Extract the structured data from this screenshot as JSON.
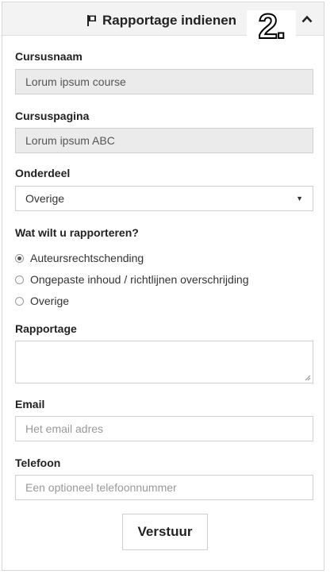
{
  "header": {
    "title": "Rapportage indienen",
    "badge": "2."
  },
  "form": {
    "course_name": {
      "label": "Cursusnaam",
      "value": "Lorum ipsum course"
    },
    "course_page": {
      "label": "Cursuspagina",
      "value": "Lorum ipsum ABC"
    },
    "section": {
      "label": "Onderdeel",
      "selected": "Overige"
    },
    "report_type": {
      "label": "Wat wilt u rapporteren?",
      "options": [
        {
          "label": "Auteursrechtschending",
          "checked": true
        },
        {
          "label": "Ongepaste inhoud / richtlijnen overschrijding",
          "checked": false
        },
        {
          "label": "Overige",
          "checked": false
        }
      ]
    },
    "report": {
      "label": "Rapportage",
      "value": ""
    },
    "email": {
      "label": "Email",
      "placeholder": "Het email adres"
    },
    "phone": {
      "label": "Telefoon",
      "placeholder": "Een optioneel telefoonnummer"
    },
    "submit_label": "Verstuur"
  }
}
